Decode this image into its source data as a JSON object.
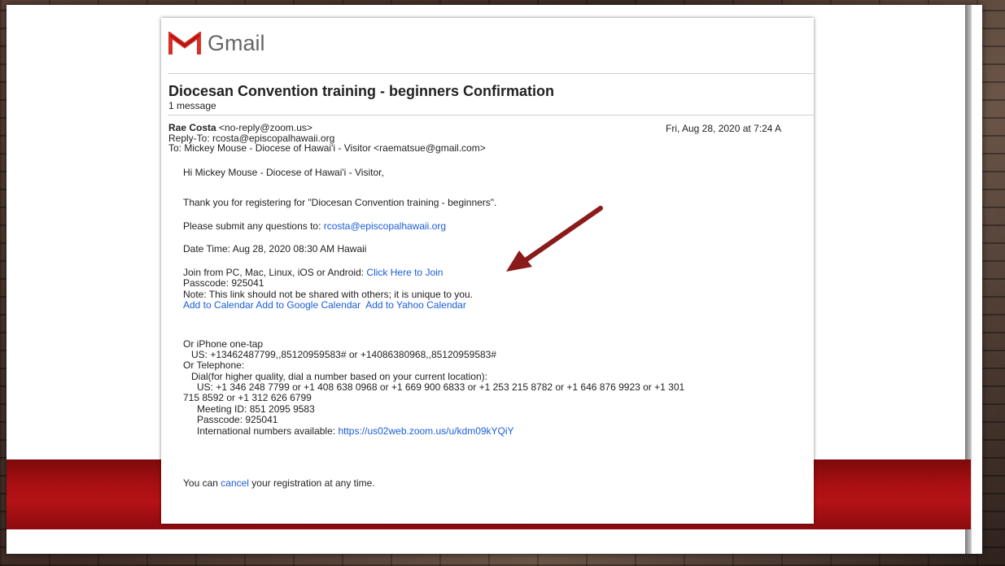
{
  "gmail": {
    "logo_text": "Gmail"
  },
  "email": {
    "subject": "Diocesan Convention training - beginners Confirmation",
    "message_count": "1 message",
    "sender_name": "Rae Costa",
    "sender_email": "<no-reply@zoom.us>",
    "reply_to": "Reply-To: rcosta@episcopalhawaii.org",
    "to": "To: Mickey Mouse - Diocese of Hawai'i - Visitor <raematsue@gmail.com>",
    "date": "Fri, Aug 28, 2020 at 7:24 A",
    "greeting": "Hi Mickey Mouse - Diocese of Hawai'i - Visitor,",
    "thanks": "Thank you for registering for \"Diocesan Convention training - beginners\".",
    "questions_prefix": "Please submit any questions to: ",
    "questions_link": "rcosta@episcopalhawaii.org",
    "datetime": "Date Time: Aug 28, 2020 08:30 AM Hawaii",
    "join_prefix": "Join from PC, Mac, Linux, iOS or Android: ",
    "join_link": "Click Here to Join",
    "passcode": "Passcode: 925041",
    "note": "Note: This link should not be shared with others; it is unique to you.",
    "add_calendar": "Add to Calendar",
    "add_google": "Add to Google Calendar",
    "add_yahoo": "Add to Yahoo Calendar",
    "iphone_label": "Or iPhone one-tap",
    "iphone_numbers": "US: +13462487799,,85120959583# or +14086380968,,85120959583#",
    "telephone_label": "Or Telephone:",
    "dial_label": "Dial(for higher quality, dial a number based on your current location):",
    "dial_numbers_1": "US: +1 346 248 7799 or +1 408 638 0968 or +1 669 900 6833 or +1 253 215 8782 or +1 646 876 9923 or +1 301",
    "dial_numbers_2": "715 8592 or +1 312 626 6799",
    "meeting_id": "Meeting ID: 851 2095 9583",
    "passcode2": "Passcode: 925041",
    "intl_prefix": "International numbers available: ",
    "intl_link": "https://us02web.zoom.us/u/kdm09kYQiY",
    "cancel_prefix": "You can ",
    "cancel_link": "cancel",
    "cancel_suffix": " your registration at any time."
  },
  "colors": {
    "link": "#1a5cdb",
    "arrow": "#8b1a1a",
    "band": "#b41216"
  }
}
